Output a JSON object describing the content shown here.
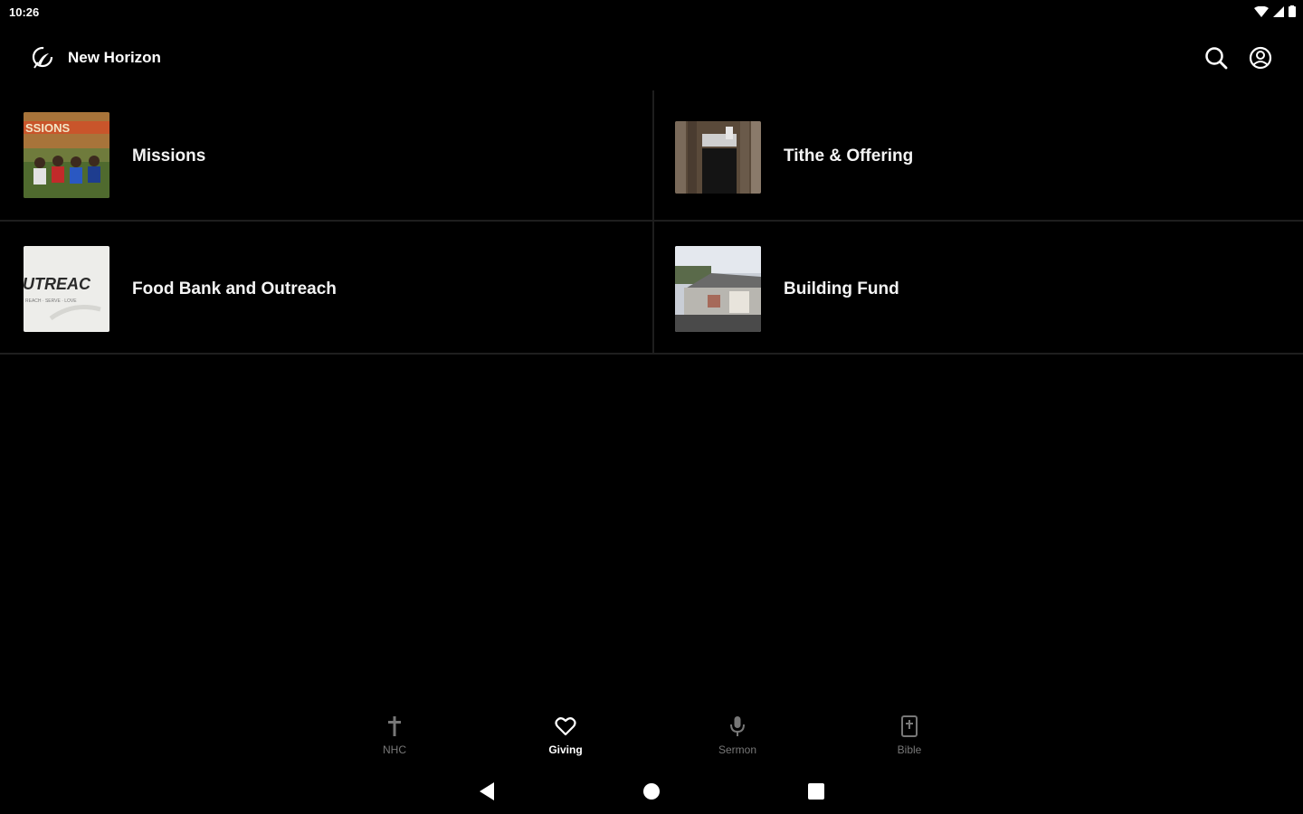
{
  "status_bar": {
    "time": "10:26"
  },
  "app_bar": {
    "title": "New Horizon"
  },
  "giving_options": [
    {
      "label": "Missions",
      "thumb_text": "SSIONS"
    },
    {
      "label": "Tithe & Offering"
    },
    {
      "label": "Food Bank and Outreach",
      "thumb_text": "UTREAC",
      "thumb_subtext": "REACH · SERVE · LOVE"
    },
    {
      "label": "Building Fund"
    }
  ],
  "bottom_nav": [
    {
      "label": "NHC",
      "icon": "cross-icon"
    },
    {
      "label": "Giving",
      "icon": "heart-icon",
      "active": true
    },
    {
      "label": "Sermon",
      "icon": "microphone-icon"
    },
    {
      "label": "Bible",
      "icon": "bible-icon"
    }
  ],
  "colors": {
    "background": "#000000",
    "divider": "#1e1e1e",
    "inactive_nav": "#777777"
  }
}
